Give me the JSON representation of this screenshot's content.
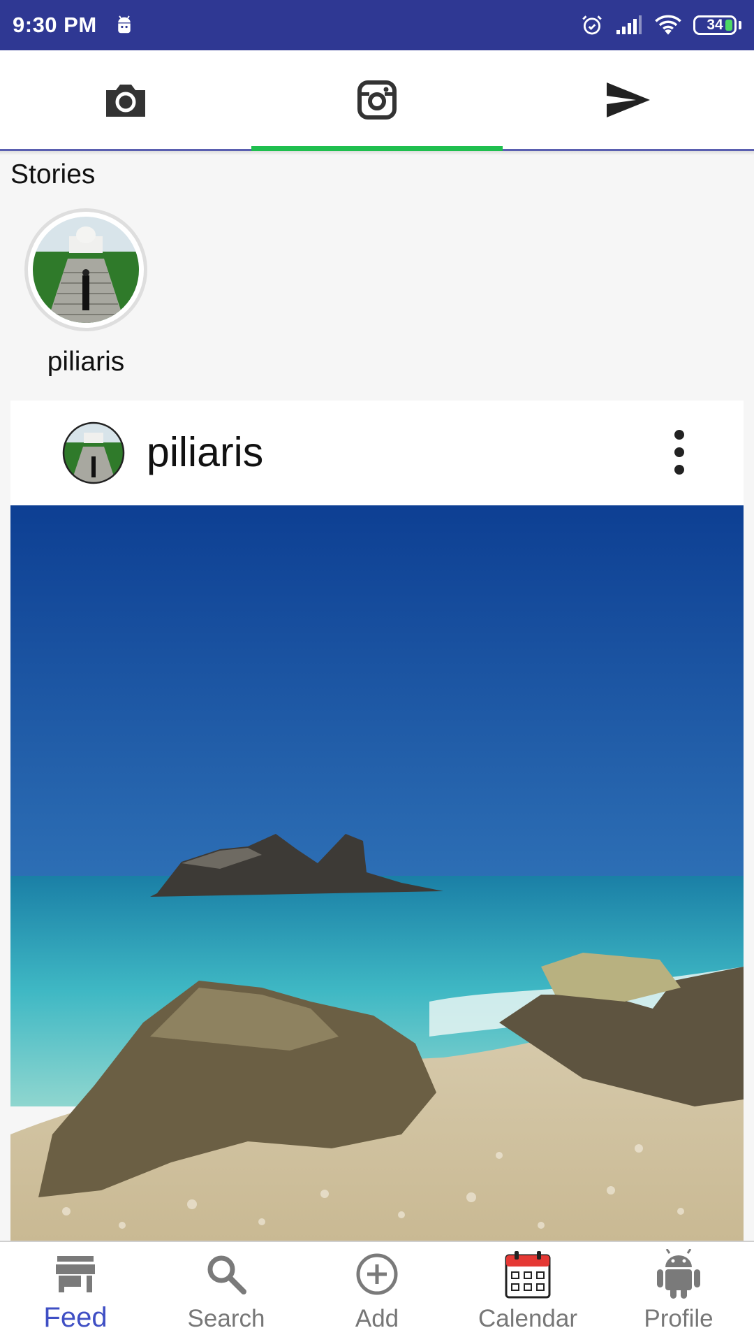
{
  "status_bar": {
    "time": "9:30 PM",
    "battery": "34",
    "icons": [
      "android-notification-icon",
      "alarm-icon",
      "signal-icon",
      "wifi-icon",
      "battery-icon"
    ]
  },
  "top_tabs": [
    {
      "name": "camera",
      "icon": "camera-icon",
      "active": false
    },
    {
      "name": "feed",
      "icon": "instagram-icon",
      "active": true
    },
    {
      "name": "direct",
      "icon": "send-icon",
      "active": false
    }
  ],
  "stories": {
    "title": "Stories",
    "items": [
      {
        "username": "piliaris"
      }
    ]
  },
  "post": {
    "username": "piliaris",
    "menu_icon": "more-vertical-icon"
  },
  "bottom_nav": {
    "items": [
      {
        "label": "Feed",
        "icon": "store-icon",
        "active": true
      },
      {
        "label": "Search",
        "icon": "search-icon",
        "active": false
      },
      {
        "label": "Add",
        "icon": "add-circle-icon",
        "active": false
      },
      {
        "label": "Calendar",
        "icon": "calendar-icon",
        "active": false
      },
      {
        "label": "Profile",
        "icon": "android-icon",
        "active": false
      }
    ]
  },
  "colors": {
    "status_bar": "#2f3893",
    "active_tab_indicator": "#1fbf4f",
    "active_nav": "#3f4fc4",
    "inactive_nav": "#777777"
  }
}
